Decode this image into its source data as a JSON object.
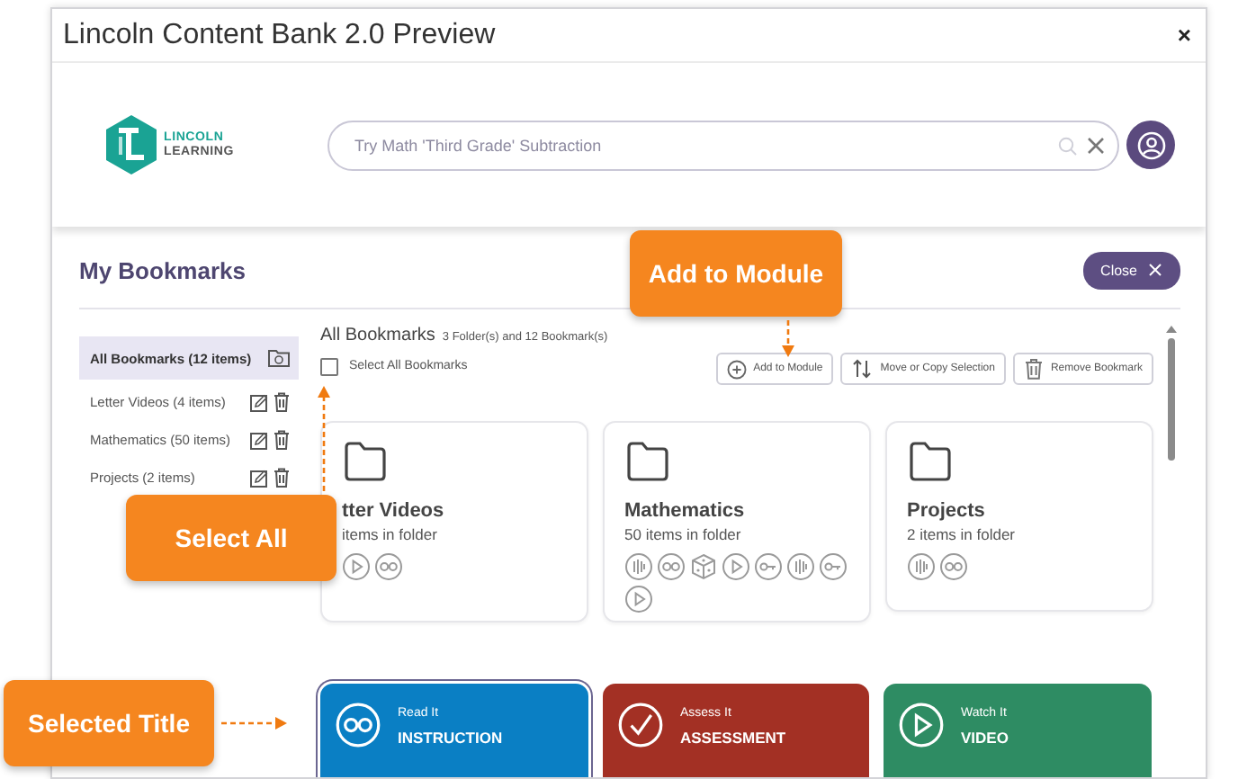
{
  "window": {
    "title": "Lincoln Content Bank 2.0 Preview",
    "close": "×"
  },
  "header": {
    "logo": {
      "line1": "LINCOLN",
      "line2": "LEARNING"
    },
    "search": {
      "placeholder": "Try Math 'Third Grade' Subtraction"
    }
  },
  "page": {
    "title": "My Bookmarks",
    "close_button": "Close"
  },
  "sidebar": {
    "items": [
      {
        "label": "All Bookmarks (12 items)",
        "selected": true
      },
      {
        "label": "Letter Videos (4 items)",
        "selected": false
      },
      {
        "label": "Mathematics (50 items)",
        "selected": false
      },
      {
        "label": "Projects (2 items)",
        "selected": false
      }
    ]
  },
  "main": {
    "title": "All Bookmarks",
    "summary": "3 Folder(s) and 12 Bookmark(s)",
    "select_all": {
      "label": "Select All Bookmarks",
      "checked": false
    },
    "actions": [
      {
        "label": "Add to Module",
        "kind": "add"
      },
      {
        "label": "Move or Copy Selection",
        "kind": "move"
      },
      {
        "label": "Remove Bookmark",
        "kind": "remove"
      }
    ],
    "folders": [
      {
        "title": "tter Videos",
        "subtitle": "items in folder",
        "resources": [
          {
            "kind": "video"
          },
          {
            "kind": "reading"
          }
        ]
      },
      {
        "title": "Mathematics",
        "subtitle": "50 items in folder",
        "resources": [
          {
            "kind": "audio"
          },
          {
            "kind": "reading"
          },
          {
            "kind": "game"
          },
          {
            "kind": "video"
          },
          {
            "kind": "vocab"
          },
          {
            "kind": "audio"
          },
          {
            "kind": "vocab"
          },
          {
            "kind": "video"
          }
        ]
      },
      {
        "title": "Projects",
        "subtitle": "2 items in folder",
        "resources": [
          {
            "kind": "audio"
          },
          {
            "kind": "reading"
          }
        ]
      }
    ]
  },
  "tiles": [
    {
      "label": "Read It",
      "type": "INSTRUCTION",
      "kind": "reading",
      "color": "#0a7fc4",
      "selected": true
    },
    {
      "label": "Assess It",
      "type": "ASSESSMENT",
      "kind": "assessment",
      "color": "#a33024",
      "selected": false
    },
    {
      "label": "Watch It",
      "type": "VIDEO",
      "kind": "video",
      "color": "#2e8c63",
      "selected": false
    }
  ],
  "callouts": [
    {
      "text": "Add to Module",
      "kind": "down"
    },
    {
      "text": "Select All",
      "kind": "up"
    },
    {
      "text": "Selected Title",
      "kind": "right"
    }
  ]
}
